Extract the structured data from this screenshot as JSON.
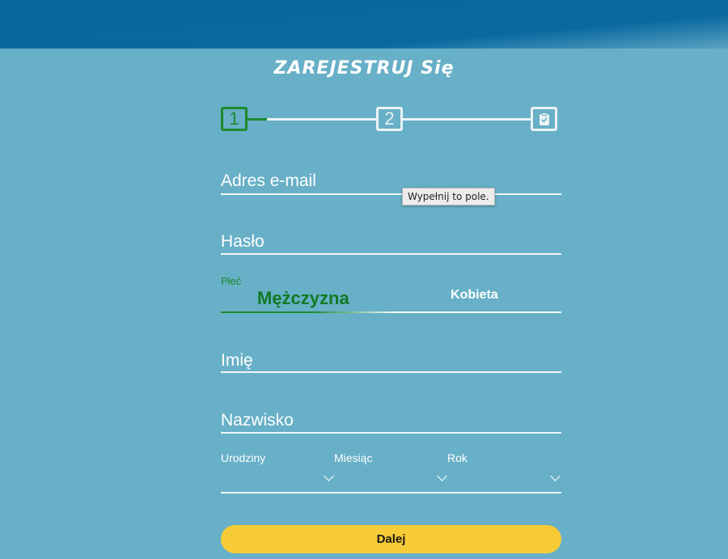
{
  "header": {
    "title": "ZAREJESTRUJ Się"
  },
  "steps": [
    {
      "label": "1",
      "state": "active"
    },
    {
      "label": "2",
      "state": "inactive"
    },
    {
      "label": "",
      "icon": "clipboard-check-icon",
      "state": "inactive"
    }
  ],
  "form": {
    "email": {
      "placeholder": "Adres e-mail",
      "value": ""
    },
    "tooltip": "Wypełnij to pole.",
    "password": {
      "placeholder": "Hasło",
      "value": ""
    },
    "gender": {
      "label": "Płeć",
      "options": [
        "Mężczyzna",
        "Kobieta"
      ],
      "selected": "Mężczyzna"
    },
    "first_name": {
      "placeholder": "Imię",
      "value": ""
    },
    "last_name": {
      "placeholder": "Nazwisko",
      "value": ""
    },
    "birthday": {
      "day_label": "Urodziny",
      "month_label": "Miesiąc",
      "year_label": "Rok"
    },
    "submit_label": "Dalej"
  },
  "colors": {
    "background": "#67b0c7",
    "header_bar": "#07679c",
    "accent_green": "#1d8a2f",
    "button_yellow": "#f7cb36"
  }
}
